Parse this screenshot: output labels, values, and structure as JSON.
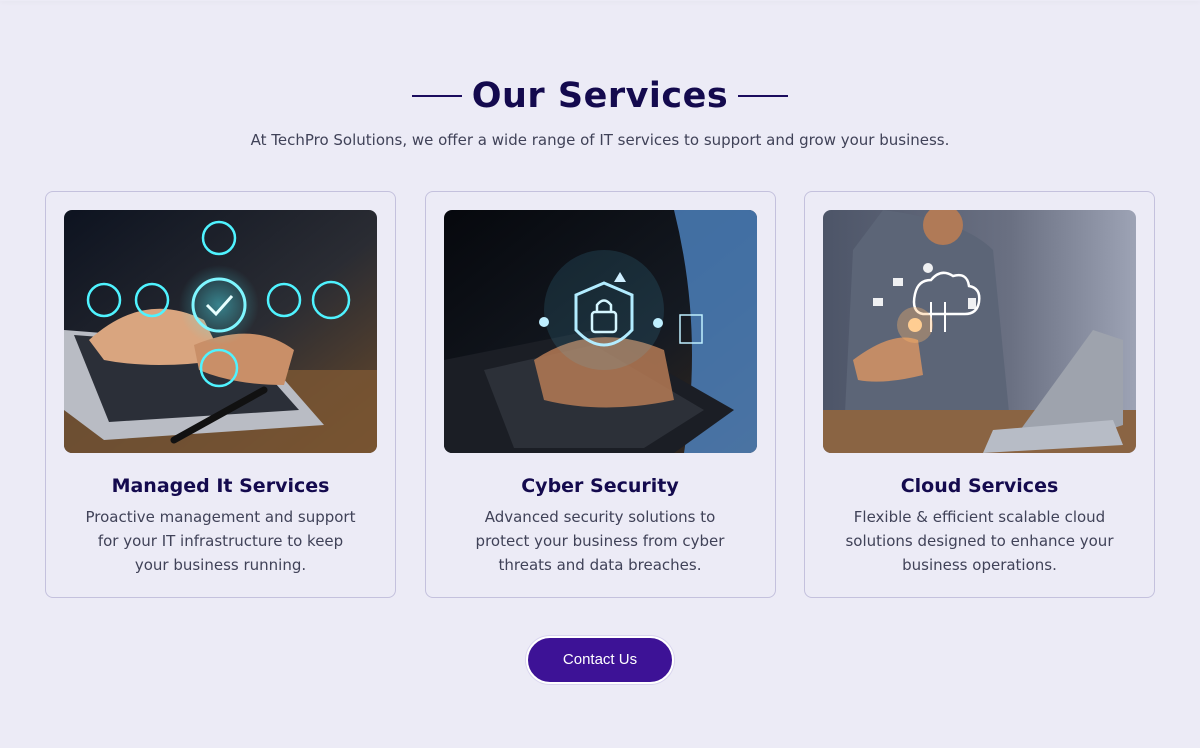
{
  "section": {
    "title": "Our Services",
    "subtitle": "At TechPro Solutions, we offer a wide range of IT services to support and grow your business."
  },
  "cards": [
    {
      "title": "Managed It Services",
      "description": "Proactive management and support for your IT infrastructure to keep your business running.",
      "image_icon": "laptop-network-icons-photo"
    },
    {
      "title": "Cyber Security",
      "description": "Advanced security solutions to protect your business from cyber threats and data breaches.",
      "image_icon": "laptop-shield-lock-photo"
    },
    {
      "title": "Cloud Services",
      "description": "Flexible & efficient scalable cloud solutions designed to enhance your business operations.",
      "image_icon": "cloud-touch-photo"
    }
  ],
  "cta": {
    "label": "Contact Us"
  },
  "colors": {
    "background": "#ecebf6",
    "heading": "#140a4e",
    "accent": "#3d1296",
    "card_border": "#c4c1dd"
  }
}
